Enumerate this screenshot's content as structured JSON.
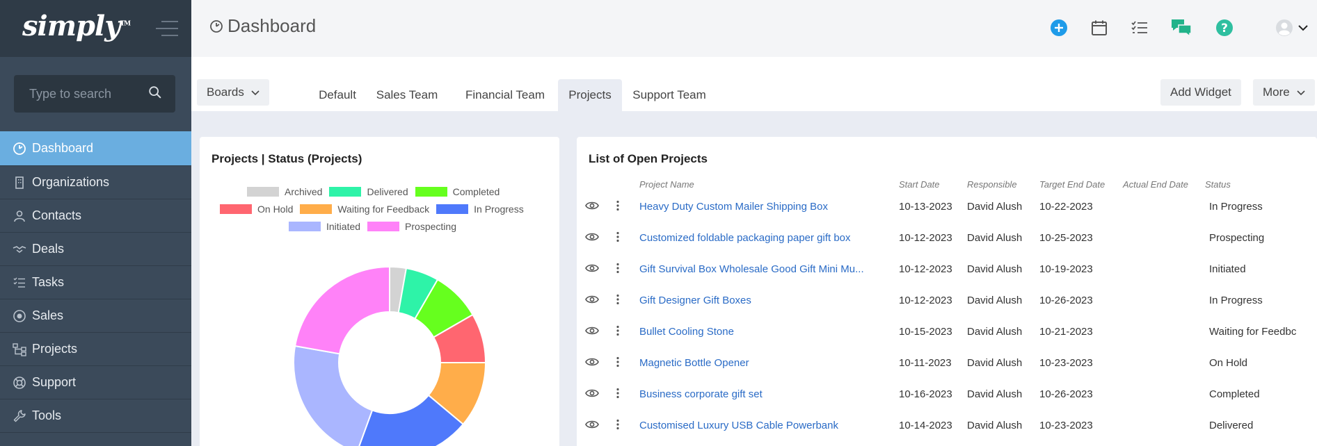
{
  "brand": {
    "logo_text": "simply",
    "tm": "TM"
  },
  "search": {
    "placeholder": "Type to search"
  },
  "sidebar": {
    "items": [
      {
        "label": "Dashboard",
        "icon": "dashboard-icon",
        "active": true
      },
      {
        "label": "Organizations",
        "icon": "building-icon"
      },
      {
        "label": "Contacts",
        "icon": "user-icon"
      },
      {
        "label": "Deals",
        "icon": "handshake-icon"
      },
      {
        "label": "Tasks",
        "icon": "checklist-icon"
      },
      {
        "label": "Sales",
        "icon": "target-icon"
      },
      {
        "label": "Projects",
        "icon": "sitemap-icon"
      },
      {
        "label": "Support",
        "icon": "lifebuoy-icon"
      },
      {
        "label": "Tools",
        "icon": "wrench-icon"
      }
    ]
  },
  "header": {
    "title": "Dashboard"
  },
  "colors": {
    "accent": "#6aaee0",
    "link": "#2a6bc6",
    "add": "#1e9be9",
    "chat": "#21b38a",
    "help": "#2fbfa0"
  },
  "tabs": {
    "boards_label": "Boards",
    "items": [
      {
        "label": "Default"
      },
      {
        "label": "Sales Team"
      },
      {
        "label": "Financial Team"
      },
      {
        "label": "Projects",
        "active": true
      },
      {
        "label": "Support Team"
      }
    ],
    "add_widget_label": "Add Widget",
    "more_label": "More"
  },
  "status_chart": {
    "title": "Projects | Status (Projects)",
    "chart_data": {
      "type": "pie",
      "variant": "donut",
      "categories": [
        "Archived",
        "Delivered",
        "Completed",
        "On Hold",
        "Waiting for Feedback",
        "In Progress",
        "Initiated",
        "Prospecting"
      ],
      "values": [
        1,
        2,
        3,
        3,
        4,
        7,
        8,
        8
      ],
      "colors": [
        "#d3d3d3",
        "#2ef3a8",
        "#66ff1e",
        "#ff6670",
        "#ffad4a",
        "#4f79fb",
        "#aab6ff",
        "#ff82f8"
      ],
      "legend": "top"
    }
  },
  "open_projects": {
    "title": "List of Open Projects",
    "columns": [
      "Project Name",
      "Start Date",
      "Responsible",
      "Target End Date",
      "Actual End Date",
      "Status"
    ],
    "rows": [
      {
        "name": "Heavy Duty Custom Mailer Shipping Box",
        "start": "10-13-2023",
        "responsible": "David Alush",
        "target": "10-22-2023",
        "actual": "",
        "status": "In Progress"
      },
      {
        "name": "Customized foldable packaging paper gift box",
        "start": "10-12-2023",
        "responsible": "David Alush",
        "target": "10-25-2023",
        "actual": "",
        "status": "Prospecting"
      },
      {
        "name": "Gift Survival Box Wholesale Good Gift Mini Mu...",
        "start": "10-12-2023",
        "responsible": "David Alush",
        "target": "10-19-2023",
        "actual": "",
        "status": "Initiated"
      },
      {
        "name": "Gift Designer Gift Boxes",
        "start": "10-12-2023",
        "responsible": "David Alush",
        "target": "10-26-2023",
        "actual": "",
        "status": "In Progress"
      },
      {
        "name": "Bullet Cooling Stone",
        "start": "10-15-2023",
        "responsible": "David Alush",
        "target": "10-21-2023",
        "actual": "",
        "status": "Waiting for Feedbc"
      },
      {
        "name": "Magnetic Bottle Opener",
        "start": "10-11-2023",
        "responsible": "David Alush",
        "target": "10-23-2023",
        "actual": "",
        "status": "On Hold"
      },
      {
        "name": "Business corporate gift set",
        "start": "10-16-2023",
        "responsible": "David Alush",
        "target": "10-26-2023",
        "actual": "",
        "status": "Completed"
      },
      {
        "name": "Customised Luxury USB Cable Powerbank",
        "start": "10-14-2023",
        "responsible": "David Alush",
        "target": "10-23-2023",
        "actual": "",
        "status": "Delivered"
      }
    ]
  }
}
